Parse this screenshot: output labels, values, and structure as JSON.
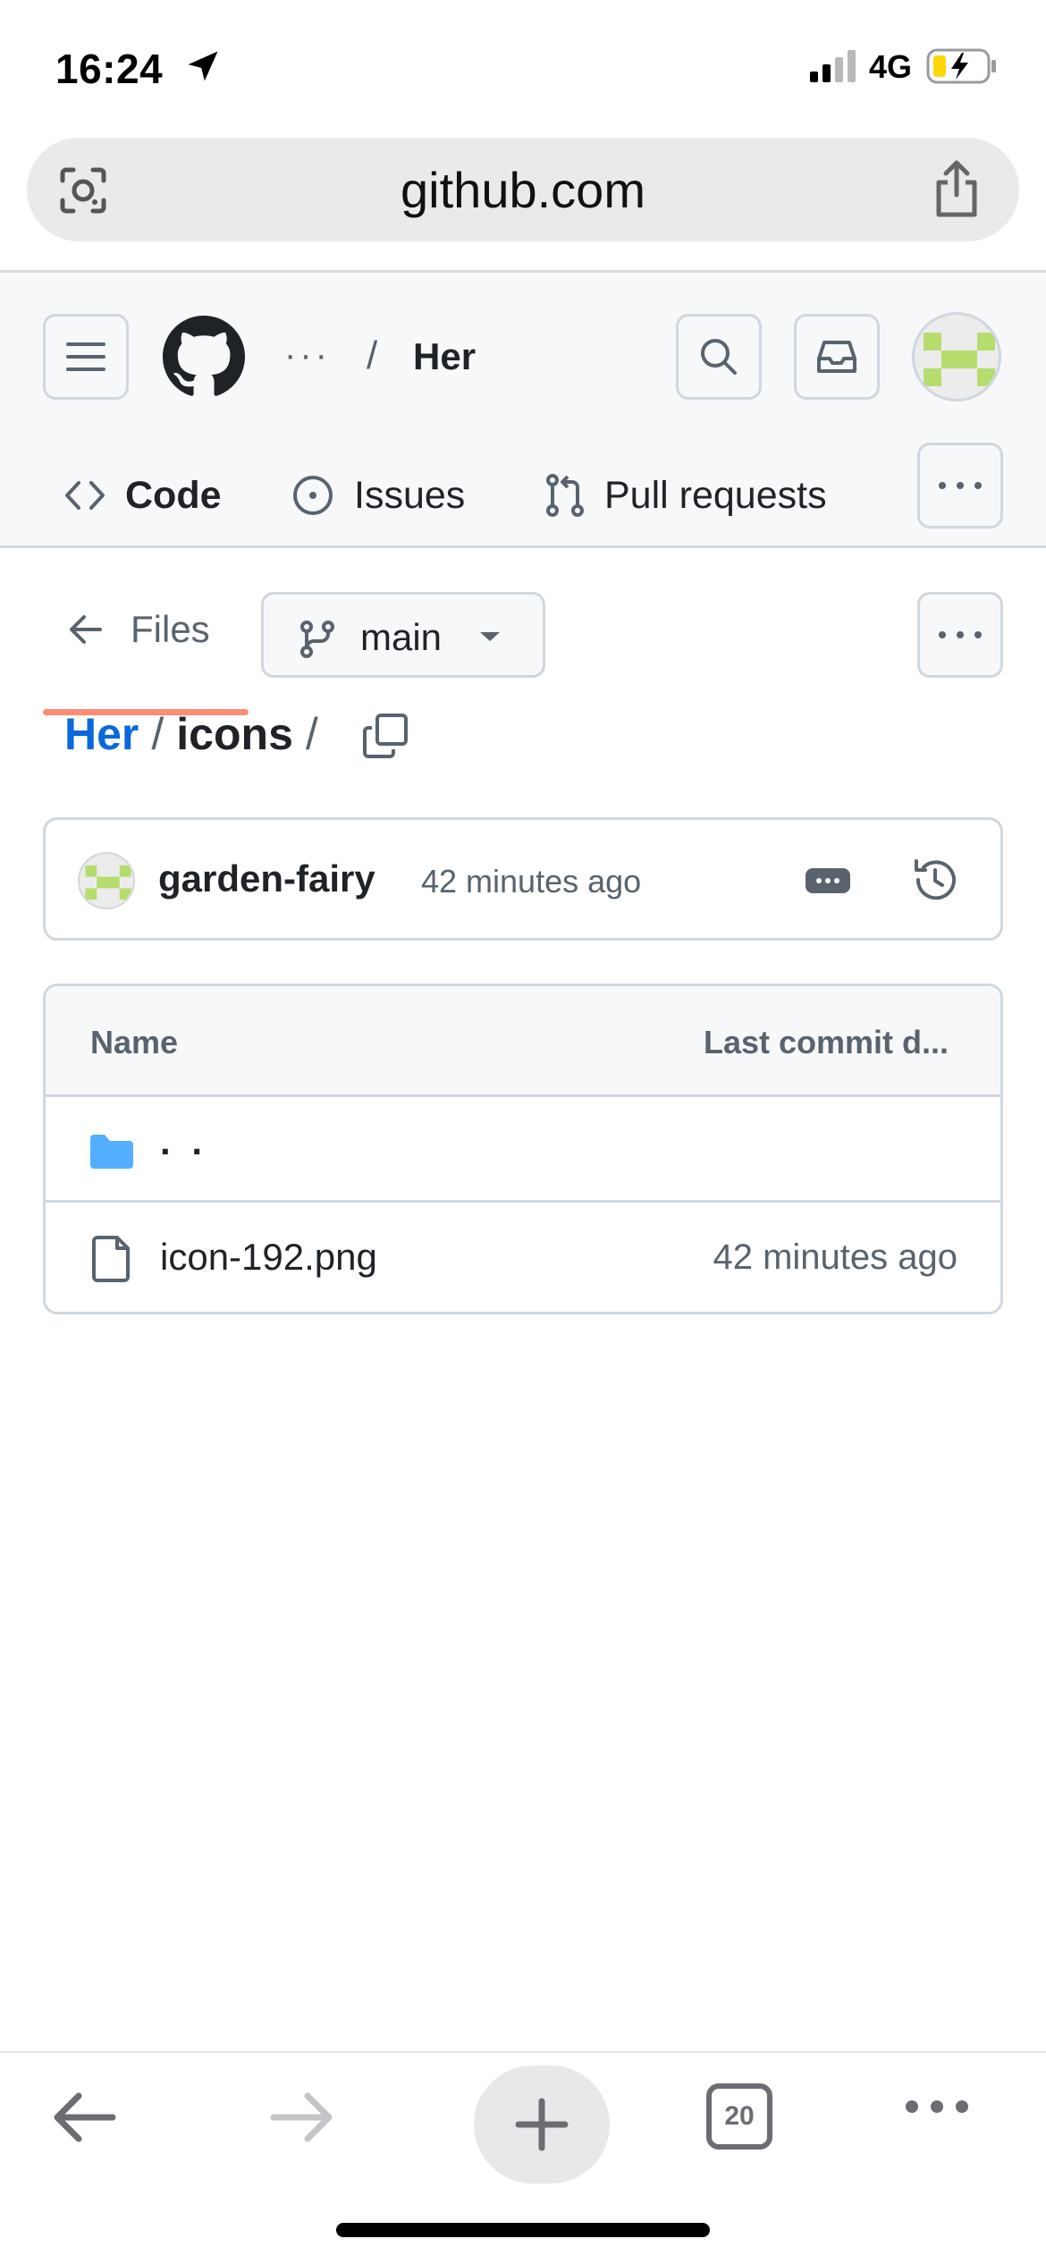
{
  "status_bar": {
    "time": "16:24",
    "network": "4G"
  },
  "browser": {
    "url": "github.com",
    "open_tabs_count": "20"
  },
  "header": {
    "breadcrumb_overflow": "···",
    "separator": "/",
    "repo_name": "Her"
  },
  "tabs": [
    {
      "label": "Code",
      "selected": true
    },
    {
      "label": "Issues",
      "selected": false
    },
    {
      "label": "Pull requests",
      "selected": false
    }
  ],
  "toolbar": {
    "files_label": "Files",
    "branch": "main"
  },
  "path": {
    "repo": "Her",
    "separator": "/",
    "directory": "icons",
    "trailing_separator": "/"
  },
  "latest_commit": {
    "author": "garden-fairy",
    "time": "42 minutes ago"
  },
  "file_table": {
    "columns": [
      "Name",
      "Last commit d..."
    ],
    "rows": [
      {
        "type": "parent",
        "name": ". .",
        "date": ""
      },
      {
        "type": "file",
        "name": "icon-192.png",
        "date": "42 minutes ago"
      }
    ]
  },
  "colors": {
    "link_blue": "#0969da",
    "tab_underline": "#fd8c73",
    "folder_blue": "#54aeff",
    "avatar_green": "#b5dd6e",
    "battery_yellow": "#ffd60a"
  },
  "icons": [
    "location-arrow-icon",
    "signal-icon",
    "battery-charging-icon",
    "lens-icon",
    "share-icon",
    "hamburger-icon",
    "github-logo-icon",
    "search-icon",
    "inbox-icon",
    "code-icon",
    "issue-icon",
    "pull-request-icon",
    "kebab-icon",
    "arrow-left-icon",
    "branch-icon",
    "caret-down-icon",
    "copy-icon",
    "ellipsis-icon",
    "history-icon",
    "folder-icon",
    "file-icon",
    "back-arrow-icon",
    "forward-arrow-icon",
    "plus-icon",
    "more-icon"
  ]
}
